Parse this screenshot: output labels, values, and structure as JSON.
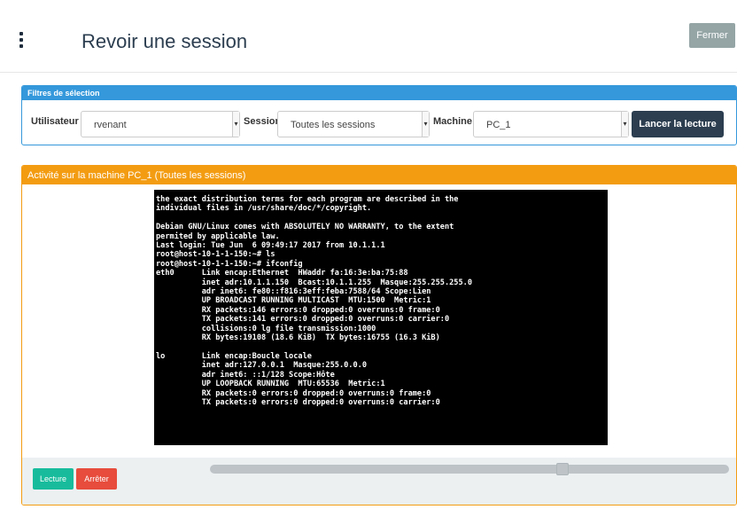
{
  "header": {
    "title": "Revoir une session",
    "close_label": "Fermer"
  },
  "filters": {
    "heading": "Filtres de sélection",
    "user_label": "Utilisateur",
    "user_value": "rvenant",
    "session_label": "Session",
    "session_value": "Toutes les sessions",
    "machine_label": "Machine",
    "machine_value": "PC_1",
    "play_label": "Lancer la lecture"
  },
  "activity": {
    "heading": "Activité sur la machine PC_1 (Toutes les sessions)",
    "terminal_lines": [
      "the exact distribution terms for each program are described in the",
      "individual files in /usr/share/doc/*/copyright.",
      "",
      "Debian GNU/Linux comes with ABSOLUTELY NO WARRANTY, to the extent",
      "permited by applicable law.",
      "Last login: Tue Jun  6 09:49:17 2017 from 10.1.1.1",
      "root@host-10-1-1-150:~# ls",
      "root@host-10-1-1-150:~# ifconfig",
      "eth0      Link encap:Ethernet  HWaddr fa:16:3e:ba:75:88",
      "          inet adr:10.1.1.150  Bcast:10.1.1.255  Masque:255.255.255.0",
      "          adr inet6: fe80::f816:3eff:feba:7588/64 Scope:Lien",
      "          UP BROADCAST RUNNING MULTICAST  MTU:1500  Metric:1",
      "          RX packets:146 errors:0 dropped:0 overruns:0 frame:0",
      "          TX packets:141 errors:0 dropped:0 overruns:0 carrier:0",
      "          collisions:0 lg file transmission:1000",
      "          RX bytes:19108 (18.6 KiB)  TX bytes:16755 (16.3 KiB)",
      "",
      "lo        Link encap:Boucle locale",
      "          inet adr:127.0.0.1  Masque:255.0.0.0",
      "          adr inet6: ::1/128 Scope:Hôte",
      "          UP LOOPBACK RUNNING  MTU:65536  Metric:1",
      "          RX packets:0 errors:0 dropped:0 overruns:0 frame:0",
      "          TX packets:0 errors:0 dropped:0 overruns:0 carrier:0"
    ],
    "read_label": "Lecture",
    "stop_label": "Arrêter",
    "progress": 0.68
  },
  "colors": {
    "primary": "#3498db",
    "warning": "#f39c12",
    "dark": "#2c3e50",
    "success": "#18bc9c",
    "danger": "#e74c3c",
    "muted": "#95a5a6"
  },
  "icons": {
    "menu": "vertical-ellipsis-icon",
    "select_caret": "caret-down-icon"
  }
}
